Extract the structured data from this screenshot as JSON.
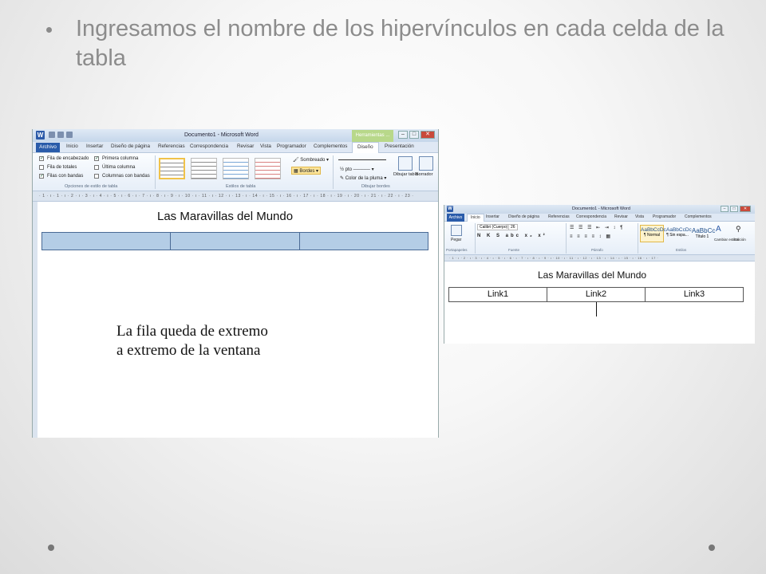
{
  "slide": {
    "title": "Ingresamos el nombre de los hipervínculos en cada celda de la tabla",
    "caption_line1": "La fila queda de extremo",
    "caption_line2": "a extremo de la ventana"
  },
  "window_large": {
    "title": "Documento1 - Microsoft Word",
    "context_tab": "Herramientas ...",
    "tabs": [
      "Archivo",
      "Inicio",
      "Insertar",
      "Diseño de página",
      "Referencias",
      "Correspondencia",
      "Revisar",
      "Vista",
      "Programador",
      "Complementos",
      "Diseño",
      "Presentación"
    ],
    "active_tab": "Diseño",
    "options": {
      "fila_encabezado": "Fila de encabezado",
      "fila_totales": "Fila de totales",
      "filas_bandas": "Filas con bandas",
      "primera_columna": "Primera columna",
      "ultima_columna": "Última columna",
      "columnas_bandas": "Columnas con bandas"
    },
    "groups": {
      "opciones": "Opciones de estilo de tabla",
      "estilos": "Estilos de tabla",
      "dibujar": "Dibujar bordes"
    },
    "buttons": {
      "sombreado": "Sombreado",
      "bordes": "Bordes",
      "pt": "½ pto",
      "color_pluma": "Color de la pluma",
      "dibujar_tabla": "Dibujar tabla",
      "borrador": "Borrador"
    },
    "ruler": "· 1 · ı · 1 · ı · 2 · ı · 3 · ı · 4 · ı · 5 · ı · 6 · ı · 7 · ı · 8 · ı · 9 · ı · 10 · ı · 11 · ı · 12 · ı · 13 · ı · 14 · ı · 15 · ı · 16 · ı · 17 · ı · 18 · ı · 19 · ı · 20 · ı · 21 · ı · 22 · ı · 23 ·",
    "doc_title": "Las Maravillas del Mundo"
  },
  "window_small": {
    "title": "Documento1 - Microsoft Word",
    "tabs": [
      "Archivo",
      "Inicio",
      "Insertar",
      "Diseño de página",
      "Referencias",
      "Correspondencia",
      "Revisar",
      "Vista",
      "Programador",
      "Complementos"
    ],
    "font_name": "Calibri (Cuerpo)",
    "font_size": "26",
    "pegar": "Pegar",
    "groups": {
      "portapapeles": "Portapapeles",
      "fuente": "Fuente",
      "parrafo": "Párrafo",
      "estilos": "Estilos"
    },
    "styles": [
      {
        "sample": "AaBbCcDc",
        "name": "¶ Normal"
      },
      {
        "sample": "AaBbCcDc",
        "name": "¶ Sin espa..."
      },
      {
        "sample": "AaBbCc",
        "name": "Título 1"
      }
    ],
    "cambiar_estilos": "Cambiar estilos",
    "edicion": "Edición",
    "ruler": "· 1 · ı · 2 · ı · 3 · ı · 4 · ı · 5 · ı · 6 · ı · 7 · ı · 8 · ı · 9 · ı · 10 · ı · 11 · ı · 12 · ı · 13 · ı · 14 · ı · 15 · ı · 16 · ı · 17 ·",
    "doc_title": "Las Maravillas del Mundo",
    "cells": [
      "Link1",
      "Link2",
      "Link3"
    ]
  }
}
